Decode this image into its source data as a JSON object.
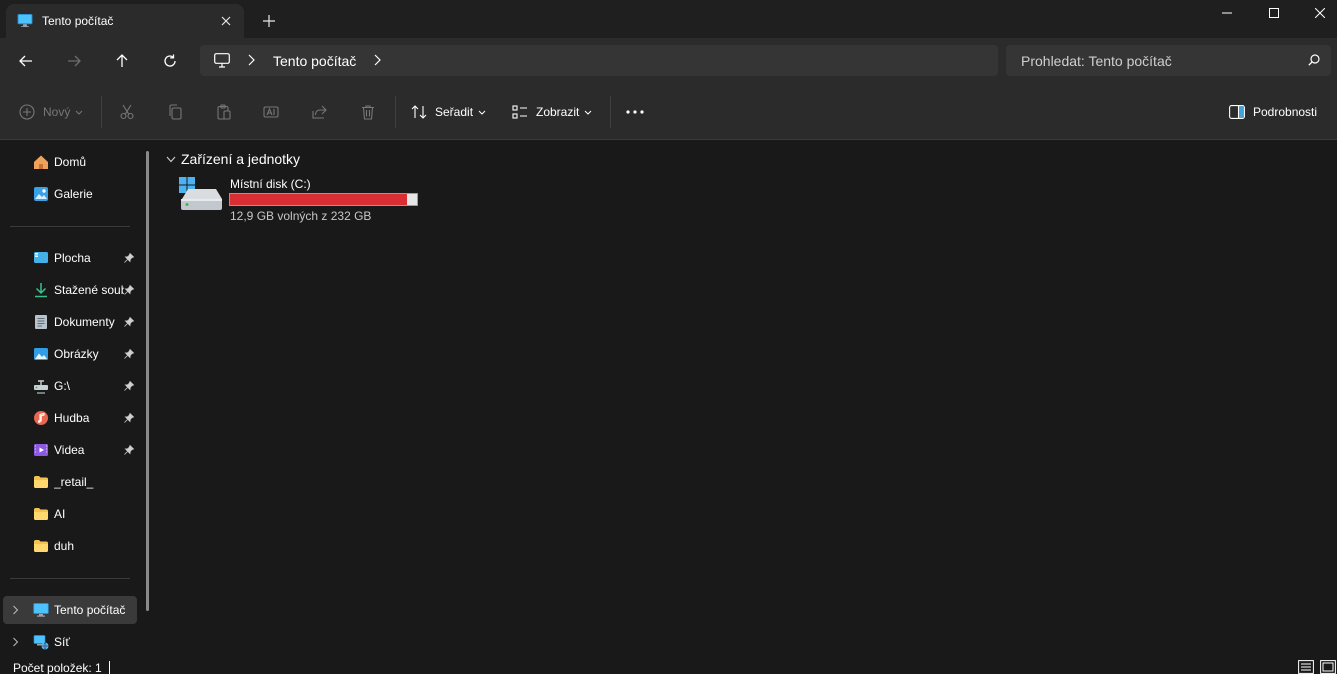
{
  "window": {
    "tab_title": "Tento počítač"
  },
  "address": {
    "crumb": "Tento počítač",
    "search_placeholder": "Prohledat: Tento počítač"
  },
  "toolbar": {
    "new_label": "Nový",
    "sort_label": "Seřadit",
    "view_label": "Zobrazit",
    "details_label": "Podrobnosti"
  },
  "sidebar": {
    "top": [
      {
        "label": "Domů",
        "icon": "home-icon"
      },
      {
        "label": "Galerie",
        "icon": "gallery-icon"
      }
    ],
    "quick": [
      {
        "label": "Plocha",
        "icon": "desktop-folder-icon",
        "pinned": true
      },
      {
        "label": "Stažené soubory",
        "icon": "download-icon",
        "pinned": true
      },
      {
        "label": "Dokumenty",
        "icon": "documents-icon",
        "pinned": true
      },
      {
        "label": "Obrázky",
        "icon": "pictures-icon",
        "pinned": true
      },
      {
        "label": "G:\\",
        "icon": "network-drive-icon",
        "pinned": true
      },
      {
        "label": "Hudba",
        "icon": "music-icon",
        "pinned": true
      },
      {
        "label": "Videa",
        "icon": "videos-icon",
        "pinned": true
      },
      {
        "label": "_retail_",
        "icon": "folder-icon",
        "pinned": false
      },
      {
        "label": "AI",
        "icon": "folder-icon",
        "pinned": false
      },
      {
        "label": "duh",
        "icon": "folder-icon",
        "pinned": false
      }
    ],
    "bottom": [
      {
        "label": "Tento počítač",
        "icon": "this-pc-icon",
        "selected": true
      },
      {
        "label": "Síť",
        "icon": "network-icon",
        "selected": false
      }
    ]
  },
  "main": {
    "group_title": "Zařízení a jednotky",
    "drives": [
      {
        "name": "Místní disk (C:)",
        "free_text": "12,9 GB volných z 232 GB",
        "used_fraction": 0.944,
        "bar_color": "#da2e35"
      }
    ]
  },
  "status": {
    "item_count": "Počet položek: 1"
  },
  "colors": {
    "accent": "#4cc2ff",
    "drive_full": "#da2e35",
    "folder": "#f4c24f"
  }
}
